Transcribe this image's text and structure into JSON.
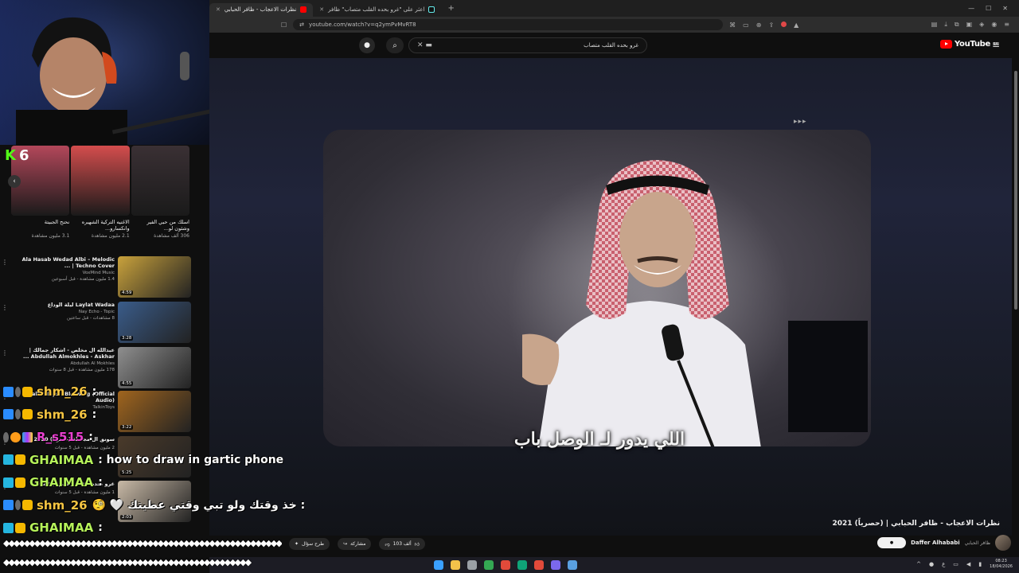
{
  "browser": {
    "tabs": [
      {
        "title": "نظرات الاعجاب - ظافر الحبابي",
        "active": true,
        "favicon": "youtube"
      },
      {
        "title": "اعثر على \"غرو بحده القلب متصاب\" ظافر",
        "active": false,
        "favicon": "tiktok"
      }
    ],
    "url": "youtube.com/watch?v=q2ymPvMvRT8"
  },
  "youtube": {
    "logo": "YouTube",
    "logo_country": "SA",
    "search_query": "غرو بحده القلب متصاب",
    "video": {
      "lyric": "اللي يدور لـ الوصل باب",
      "title": "نظرات الاعجاب - ظافر الحبابي | (حصرياً) 2021",
      "channel": "Daffer Alhababi",
      "channel_ar": "ظافر الحبابي",
      "likes": "103 ألف",
      "share": "مشاركة",
      "ask": "طرح سؤال"
    },
    "shorts": [
      {
        "title": "نحنح الجبيتة",
        "views": "3.1 مليون مشاهدة",
        "color": "#b3475a"
      },
      {
        "title": "الاغنيه التركية الشهيره وانكسارو...",
        "views": "2.1 مليون مشاهدة",
        "color": "#d44d4d"
      },
      {
        "title": "اسلك من حبي الفير وشئون لو...",
        "views": "306 ألف مشاهدة",
        "color": "#3a3034"
      }
    ],
    "recommended": [
      {
        "title": "Ala Hasab Wedad Albi – Melodic Techno Cover | ...",
        "channel": "VoxMind Music",
        "views": "1.4 مليون مشاهدة - قبل أسبوعين",
        "duration": "4:59",
        "color": "#c9a23c"
      },
      {
        "title": "Laylat Wadaa ليلة الوداع",
        "channel": "Nay Echo - Topic",
        "views": "8 مشاهدات - قبل ساعتين",
        "duration": "3:28",
        "color": "#3a5c8a"
      },
      {
        "title": "عبدالله ال مخلص - اشكار جمالك | Abdullah Almokhles - Askhar ...",
        "channel": "Abdullah Al Mokhles",
        "views": "178 مليون مشاهدة - قبل 8 سنوات",
        "duration": "4:55",
        "color": "#8f8f8f"
      },
      {
        "title": "TalkinToys - Bleeding (Official Audio)",
        "channel": "TalkinToys",
        "views": "",
        "duration": "3:22",
        "color": "#a0651e"
      },
      {
        "title": "سونق ال مجاملة (حصرياً) 2020",
        "channel": "",
        "views": "2 مليون مشاهدة - قبل 5 سنوات",
        "duration": "5:25",
        "color": "#4a3a2a"
      },
      {
        "title": "غرو بحده القلب (حصرياً) 2020",
        "channel": "",
        "views": "1 مليون مشاهدة - قبل 5 سنوات",
        "duration": "2:03",
        "color": "#c8b9a6"
      }
    ]
  },
  "stream": {
    "platform_icon": "kick-logo",
    "viewer_count": "6"
  },
  "chat": [
    {
      "user": "shm_26",
      "text": ":",
      "color": "#f5c542",
      "badges": [
        "b-blue",
        "b-grey",
        "b-gold"
      ]
    },
    {
      "user": "shm_26",
      "text": ":",
      "color": "#f5c542",
      "badges": [
        "b-blue",
        "b-grey",
        "b-gold"
      ]
    },
    {
      "user": "R_s515",
      "text": ":",
      "color": "#e940d0",
      "badges": [
        "b-grey",
        "b-orange",
        "b-multi"
      ]
    },
    {
      "user": "GHAIMAA",
      "text": ": how to draw in gartic phone",
      "color": "#b6f25a",
      "badges": [
        "b-cyan",
        "b-gold"
      ]
    },
    {
      "user": "GHAIMAA",
      "text": ":",
      "color": "#b6f25a",
      "badges": [
        "b-cyan",
        "b-gold"
      ]
    },
    {
      "user": "shm_26",
      "text": ": خذ وقتك ولو تبي وقتي عطيتك 🤍 🧐",
      "color": "#f5c542",
      "badges": [
        "b-blue",
        "b-grey",
        "b-gold"
      ]
    },
    {
      "user": "GHAIMAA",
      "text": ":",
      "color": "#b6f25a",
      "badges": [
        "b-cyan",
        "b-gold"
      ]
    }
  ],
  "spam_line_1": "◆◆◆◆◆◆◆◆◆◆◆◆◆◆◆◆◆◆◆◆◆◆◆◆◆◆◆◆◆◆◆◆◆◆◆◆◆◆◆◆◆◆◆◆◆◆◆◆◆◆◆◆◆◆◆◆◆◆◆◆",
  "spam_line_2": "◆◆◆◆◆◆◆◆◆◆◆◆◆◆◆◆◆◆◆◆◆◆◆◆◆◆◆◆◆◆◆◆◆◆◆◆◆◆◆◆◆◆◆◆◆◆◆◆",
  "taskbar": {
    "time": "08:23",
    "date": "18/04/2026",
    "lang": "ع",
    "apps": [
      "#3aa0ff",
      "#f2c24a",
      "#9aa0a6",
      "#34a853",
      "#e24a3a",
      "#0fa378",
      "#e24a3a",
      "#7b68ee",
      "#5aa0e0"
    ]
  }
}
